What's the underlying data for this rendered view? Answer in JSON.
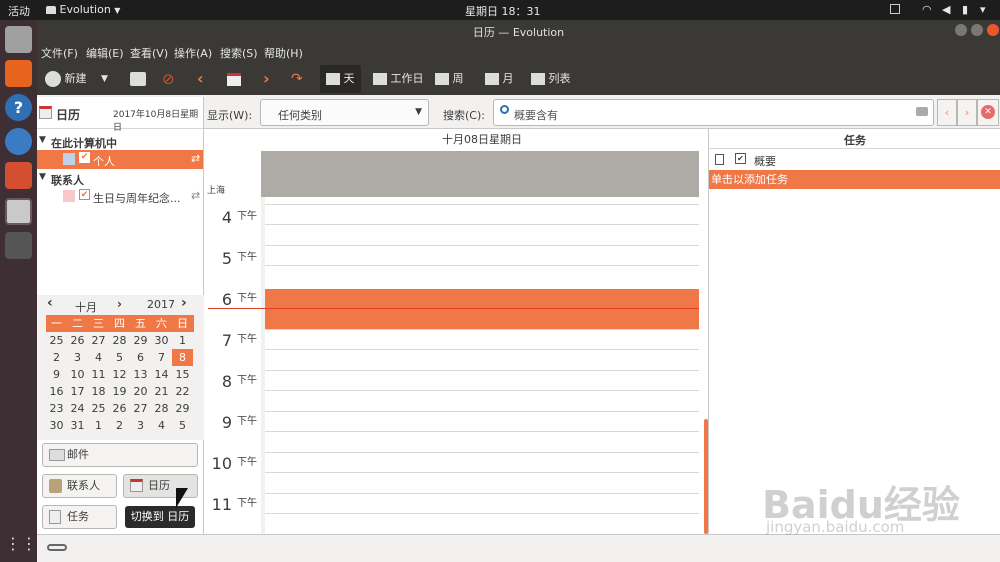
{
  "topbar": {
    "activities": "活动",
    "app": "Evolution",
    "clock": "星期日 18：31"
  },
  "window": {
    "title": "日历 — Evolution"
  },
  "menu": [
    "文件(F)",
    "编辑(E)",
    "查看(V)",
    "操作(A)",
    "搜索(S)",
    "帮助(H)"
  ],
  "toolbar": {
    "new_label": "新建",
    "view_day": "天",
    "view_workweek": "工作日",
    "view_week": "周",
    "view_month": "月",
    "view_list": "列表"
  },
  "sidebar": {
    "header": "日历",
    "date": "2017年10月8日星期日",
    "groups": [
      {
        "name": "在此计算机中",
        "items": [
          "个人"
        ]
      },
      {
        "name": "联系人",
        "items": [
          "生日与周年纪念..."
        ]
      }
    ]
  },
  "minical": {
    "month": "十月",
    "year": "2017",
    "weekdays": [
      "一",
      "二",
      "三",
      "四",
      "五",
      "六",
      "日"
    ],
    "weeks": [
      [
        "25",
        "26",
        "27",
        "28",
        "29",
        "30",
        "1"
      ],
      [
        "2",
        "3",
        "4",
        "5",
        "6",
        "7",
        "8"
      ],
      [
        "9",
        "10",
        "11",
        "12",
        "13",
        "14",
        "15"
      ],
      [
        "16",
        "17",
        "18",
        "19",
        "20",
        "21",
        "22"
      ],
      [
        "23",
        "24",
        "25",
        "26",
        "27",
        "28",
        "29"
      ],
      [
        "30",
        "31",
        "1",
        "2",
        "3",
        "4",
        "5"
      ]
    ],
    "selected": "8"
  },
  "switcher": {
    "mail": "邮件",
    "contacts": "联系人",
    "calendar": "日历",
    "tasks": "任务",
    "tooltip": "切换到 日历"
  },
  "filter": {
    "show_label": "显示(W):",
    "category": "任何类别",
    "search_label": "搜索(C):",
    "search_placeholder": "概要含有"
  },
  "dayview": {
    "header": "十月08日星期日",
    "timezone": "上海",
    "hours": [
      {
        "h": "4",
        "ap": "下午"
      },
      {
        "h": "5",
        "ap": "下午"
      },
      {
        "h": "6",
        "ap": "下午"
      },
      {
        "h": "7",
        "ap": "下午"
      },
      {
        "h": "8",
        "ap": "下午"
      },
      {
        "h": "9",
        "ap": "下午"
      },
      {
        "h": "10",
        "ap": "下午"
      },
      {
        "h": "11",
        "ap": "下午"
      }
    ]
  },
  "tasks": {
    "title": "任务",
    "col_summary": "概要",
    "add_hint": "单击以添加任务"
  },
  "watermark": {
    "brand": "Baidu经验",
    "url": "jingyan.baidu.com"
  },
  "colors": {
    "accent": "#f07746",
    "chrome": "#3b3935",
    "launcher": "#3e2f34"
  }
}
